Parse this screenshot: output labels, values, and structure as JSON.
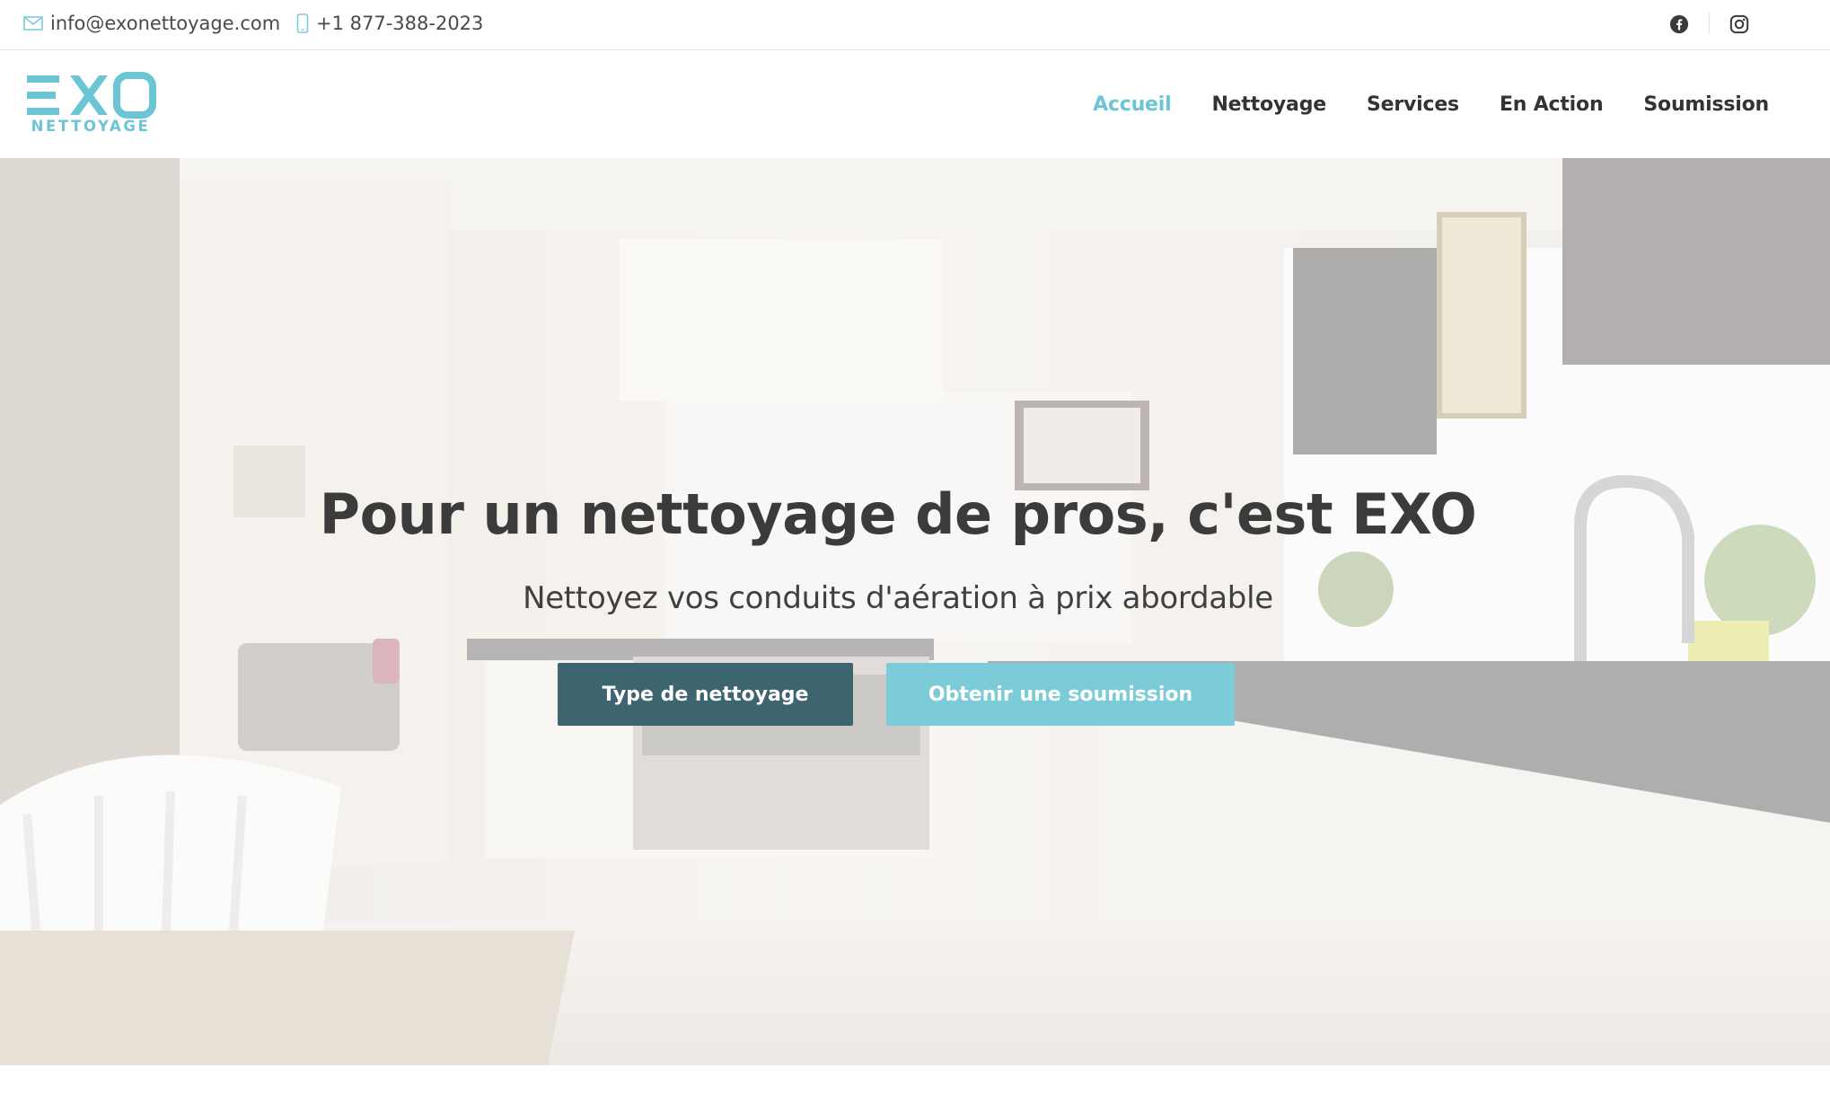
{
  "topbar": {
    "email": "info@exonettoyage.com",
    "phone": "+1 877-388-2023",
    "icons": {
      "email": "envelope-icon",
      "phone": "mobile-phone-icon",
      "facebook": "facebook-icon",
      "instagram": "instagram-icon"
    }
  },
  "header": {
    "logo": {
      "line1": "EXO",
      "line2": "NETTOYAGE"
    },
    "nav": [
      {
        "label": "Accueil",
        "active": true
      },
      {
        "label": "Nettoyage"
      },
      {
        "label": "Services"
      },
      {
        "label": "En Action"
      },
      {
        "label": "Soumission"
      }
    ]
  },
  "hero": {
    "title": "Pour un nettoyage de pros, c'est EXO",
    "subtitle": "Nettoyez vos conduits d'aération à prix abordable",
    "buttons": {
      "primary": "Type de nettoyage",
      "secondary": "Obtenir une soumission"
    }
  },
  "colors": {
    "accent": "#6cc5d4",
    "primary_button": "#3d6570",
    "secondary_button": "#7ccbd9",
    "text_dark": "#333333"
  }
}
